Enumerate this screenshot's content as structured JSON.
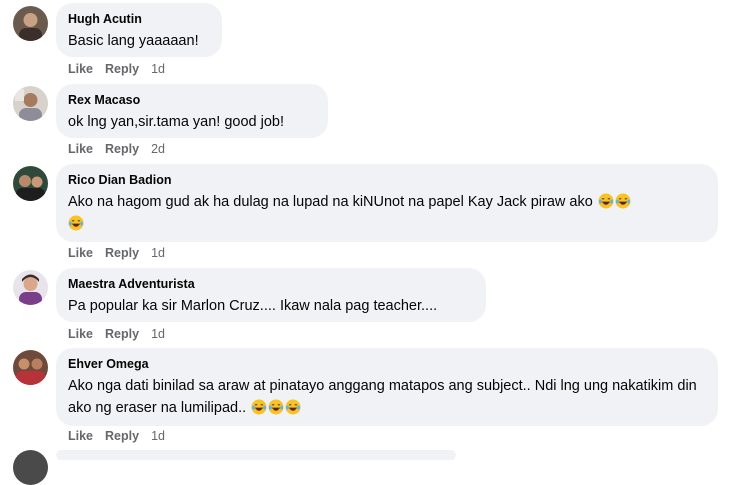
{
  "comments": [
    {
      "author": "Hugh Acutin",
      "text": "Basic lang yaaaaan!",
      "emojis": [],
      "like_label": "Like",
      "reply_label": "Reply",
      "time": "1d",
      "avatar_icon": "user-avatar-photo"
    },
    {
      "author": "Rex Macaso",
      "text": "ok lng yan,sir.tama yan! good job!",
      "emojis": [],
      "like_label": "Like",
      "reply_label": "Reply",
      "time": "2d",
      "avatar_icon": "user-avatar-photo"
    },
    {
      "author": "Rico Dian Badion",
      "text": "Ako na hagom gud ak ha dulag na lupad na kiNUnot na papel Kay Jack piraw ako",
      "emojis": [
        "laughing-tears-emoji",
        "laughing-tears-emoji",
        "laughing-tears-emoji"
      ],
      "like_label": "Like",
      "reply_label": "Reply",
      "time": "1d",
      "avatar_icon": "user-avatar-photo"
    },
    {
      "author": "Maestra Adventurista",
      "text": "Pa popular ka sir Marlon Cruz.... Ikaw nala pag teacher....",
      "emojis": [],
      "like_label": "Like",
      "reply_label": "Reply",
      "time": "1d",
      "avatar_icon": "user-avatar-photo"
    },
    {
      "author": "Ehver Omega",
      "text": "Ako nga dati binilad sa araw at pinatayo anggang matapos ang subject.. Ndi lng ung nakatikim din ako ng eraser na lumilipad..",
      "emojis": [
        "laughing-tears-emoji",
        "laughing-tears-emoji",
        "laughing-tears-emoji"
      ],
      "like_label": "Like",
      "reply_label": "Reply",
      "time": "1d",
      "avatar_icon": "user-avatar-photo"
    }
  ],
  "colors": {
    "bubble_bg": "#f0f2f5",
    "text": "#050505",
    "meta": "#65676b",
    "emoji_face": "#f7c325"
  }
}
